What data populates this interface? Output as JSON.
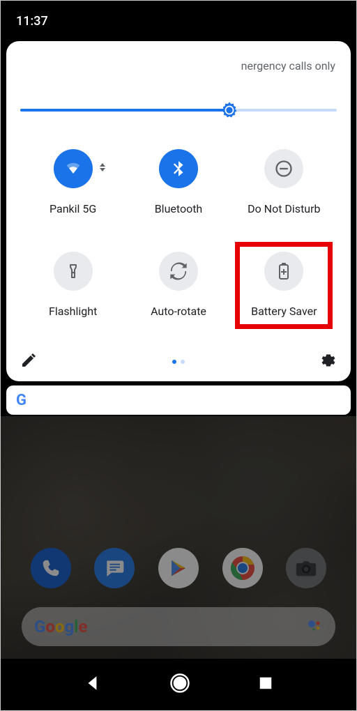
{
  "status": {
    "time": "11:37"
  },
  "quick_settings": {
    "carrier_text": "nergency calls only",
    "brightness_percent": 66,
    "tiles": [
      {
        "label": "Pankil 5G",
        "active": true
      },
      {
        "label": "Bluetooth",
        "active": true
      },
      {
        "label": "Do Not Disturb",
        "active": false
      },
      {
        "label": "Flashlight",
        "active": false
      },
      {
        "label": "Auto-rotate",
        "active": false
      },
      {
        "label": "Battery Saver",
        "active": false,
        "highlighted": true
      }
    ],
    "page_dots": {
      "count": 2,
      "active": 0
    }
  },
  "notification": {
    "app_initial": "G"
  },
  "colors": {
    "accent": "#1a73e8",
    "tile_inactive": "#e8eaed",
    "highlight": "#e60000"
  }
}
